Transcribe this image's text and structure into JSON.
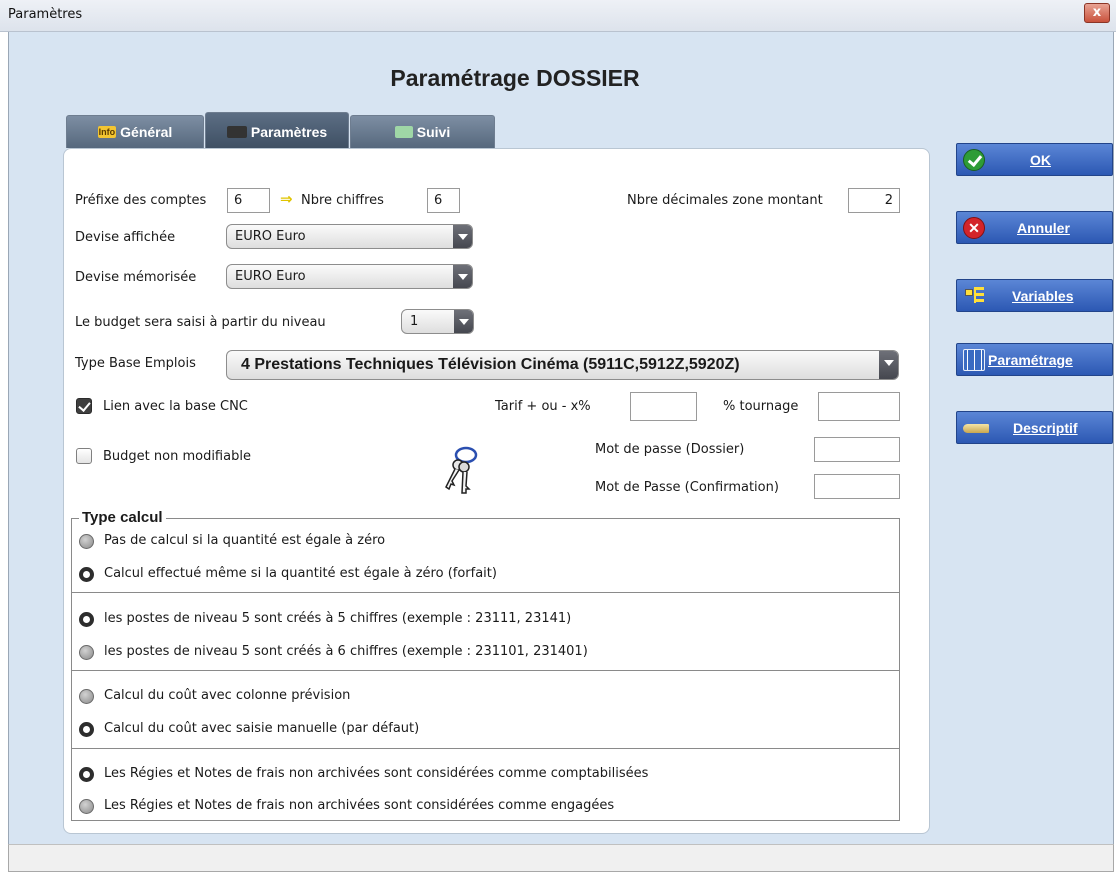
{
  "window": {
    "title": "Paramètres",
    "close": "x"
  },
  "page_title": "Paramétrage DOSSIER",
  "tabs": [
    {
      "label": "Général",
      "icon": "info-icon",
      "icon_text": "Info"
    },
    {
      "label": "Paramètres",
      "icon": "parametres-icon",
      "icon_text": ""
    },
    {
      "label": "Suivi",
      "icon": "suivi-icon",
      "icon_text": ""
    }
  ],
  "form": {
    "prefixe_label": "Préfixe des comptes",
    "prefixe_value": "6",
    "nbre_chiffres_label": "Nbre chiffres",
    "nbre_chiffres_value": "6",
    "decimales_label": "Nbre décimales zone montant",
    "decimales_value": "2",
    "devise_affichee_label": "Devise affichée",
    "devise_affichee_value": "EURO  Euro",
    "devise_memorisee_label": "Devise mémorisée",
    "devise_memorisee_value": "EURO  Euro",
    "budget_niveau_label": "Le budget sera saisi à partir du niveau",
    "budget_niveau_value": "1",
    "type_base_label": "Type Base Emplois",
    "type_base_value": "4 Prestations Techniques Télévision Cinéma (5911C,5912Z,5920Z)",
    "lien_cnc_label": "Lien avec la base CNC",
    "lien_cnc_checked": true,
    "tarif_label": "Tarif + ou -  x%",
    "tarif_value": "",
    "tournage_label": "% tournage",
    "tournage_value": "",
    "budget_non_modifiable_label": "Budget non modifiable",
    "budget_non_modifiable_checked": false,
    "mdp_dossier_label": "Mot de passe (Dossier)",
    "mdp_dossier_value": "",
    "mdp_confirmation_label": "Mot de Passe (Confirmation)",
    "mdp_confirmation_value": ""
  },
  "type_calcul": {
    "title": "Type calcul",
    "options": [
      {
        "label": "Pas de calcul si la quantité est égale à zéro",
        "selected": false
      },
      {
        "label": "Calcul effectué même si la quantité est égale à zéro (forfait)",
        "selected": true
      },
      {
        "label": "les postes de niveau 5 sont créés à 5 chiffres (exemple : 23111, 23141)",
        "selected": true
      },
      {
        "label": "les postes de niveau 5 sont créés à 6 chiffres (exemple : 231101, 231401)",
        "selected": false
      },
      {
        "label": "Calcul du coût avec colonne prévision",
        "selected": false
      },
      {
        "label": "Calcul du coût avec saisie manuelle (par défaut)",
        "selected": true
      },
      {
        "label": "Les Régies et Notes de frais non archivées sont considérées comme comptabilisées",
        "selected": true
      },
      {
        "label": "Les Régies et Notes de frais non archivées sont considérées comme engagées",
        "selected": false
      }
    ]
  },
  "side_buttons": {
    "ok": "OK",
    "annuler": "Annuler",
    "variables": "Variables",
    "parametrage": "Paramétrage",
    "descriptif": "Descriptif"
  },
  "colors": {
    "client_bg": "#d7e4f2",
    "button_blue": "#2c58b3",
    "tab_active": "#3d4e62"
  }
}
